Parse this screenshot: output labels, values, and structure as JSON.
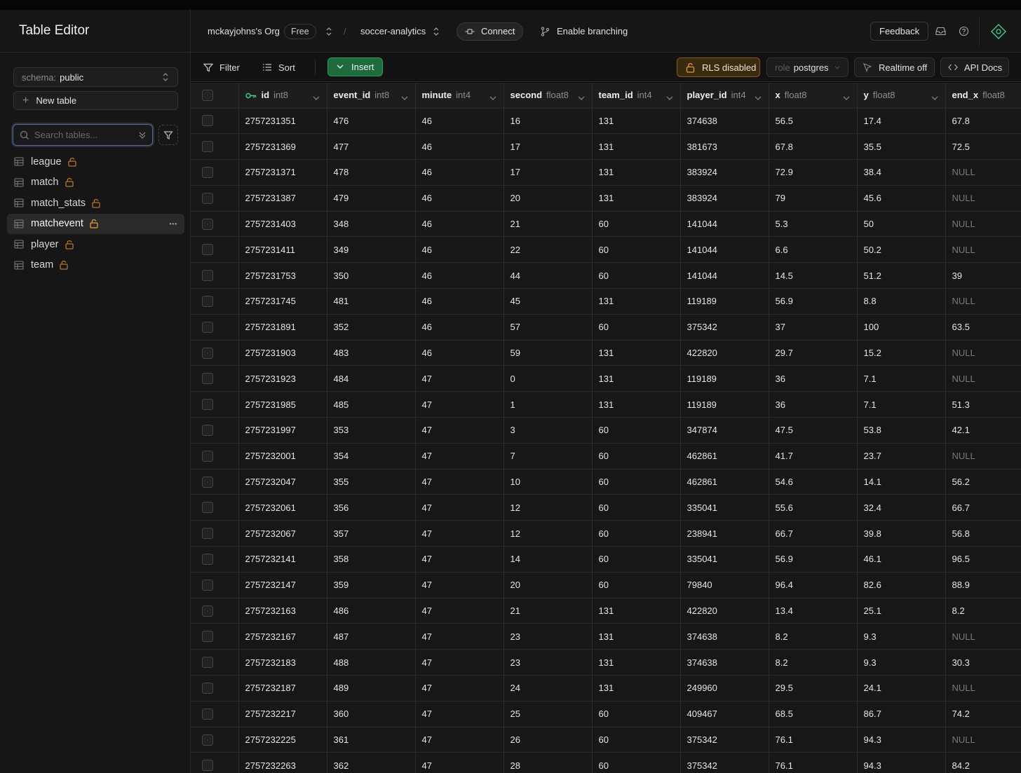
{
  "sidebar": {
    "title": "Table Editor",
    "schema_label": "schema:",
    "schema_value": "public",
    "new_table": "New table",
    "search_placeholder": "Search tables...",
    "tables": [
      {
        "name": "league",
        "active": false
      },
      {
        "name": "match",
        "active": false
      },
      {
        "name": "match_stats",
        "active": false
      },
      {
        "name": "matchevent",
        "active": true
      },
      {
        "name": "player",
        "active": false
      },
      {
        "name": "team",
        "active": false
      }
    ]
  },
  "topbar": {
    "org": "mckayjohns's Org",
    "plan": "Free",
    "separator": "/",
    "project": "soccer-analytics",
    "connect": "Connect",
    "branching": "Enable branching",
    "feedback": "Feedback"
  },
  "toolbar": {
    "filter": "Filter",
    "sort": "Sort",
    "insert": "Insert",
    "rls": "RLS disabled",
    "role_label": "role",
    "role_value": "postgres",
    "realtime": "Realtime off",
    "api_docs": "API Docs"
  },
  "colors": {
    "insert_green": "#1e6b3e",
    "rls_warning": "#8a5a1a",
    "lock_orange": "#d08a2a",
    "key_green": "#3ecf8e"
  },
  "grid": {
    "columns": [
      {
        "name": "id",
        "type": "int8",
        "primary": true
      },
      {
        "name": "event_id",
        "type": "int8"
      },
      {
        "name": "minute",
        "type": "int4"
      },
      {
        "name": "second",
        "type": "float8"
      },
      {
        "name": "team_id",
        "type": "int4"
      },
      {
        "name": "player_id",
        "type": "int4"
      },
      {
        "name": "x",
        "type": "float8"
      },
      {
        "name": "y",
        "type": "float8"
      },
      {
        "name": "end_x",
        "type": "float8"
      }
    ],
    "rows": [
      [
        "2757231351",
        "476",
        "46",
        "16",
        "131",
        "374638",
        "56.5",
        "17.4",
        "67.8"
      ],
      [
        "2757231369",
        "477",
        "46",
        "17",
        "131",
        "381673",
        "67.8",
        "35.5",
        "72.5"
      ],
      [
        "2757231371",
        "478",
        "46",
        "17",
        "131",
        "383924",
        "72.9",
        "38.4",
        "NULL"
      ],
      [
        "2757231387",
        "479",
        "46",
        "20",
        "131",
        "383924",
        "79",
        "45.6",
        "NULL"
      ],
      [
        "2757231403",
        "348",
        "46",
        "21",
        "60",
        "141044",
        "5.3",
        "50",
        "NULL"
      ],
      [
        "2757231411",
        "349",
        "46",
        "22",
        "60",
        "141044",
        "6.6",
        "50.2",
        "NULL"
      ],
      [
        "2757231753",
        "350",
        "46",
        "44",
        "60",
        "141044",
        "14.5",
        "51.2",
        "39"
      ],
      [
        "2757231745",
        "481",
        "46",
        "45",
        "131",
        "119189",
        "56.9",
        "8.8",
        "NULL"
      ],
      [
        "2757231891",
        "352",
        "46",
        "57",
        "60",
        "375342",
        "37",
        "100",
        "63.5"
      ],
      [
        "2757231903",
        "483",
        "46",
        "59",
        "131",
        "422820",
        "29.7",
        "15.2",
        "NULL"
      ],
      [
        "2757231923",
        "484",
        "47",
        "0",
        "131",
        "119189",
        "36",
        "7.1",
        "NULL"
      ],
      [
        "2757231985",
        "485",
        "47",
        "1",
        "131",
        "119189",
        "36",
        "7.1",
        "51.3"
      ],
      [
        "2757231997",
        "353",
        "47",
        "3",
        "60",
        "347874",
        "47.5",
        "53.8",
        "42.1"
      ],
      [
        "2757232001",
        "354",
        "47",
        "7",
        "60",
        "462861",
        "41.7",
        "23.7",
        "NULL"
      ],
      [
        "2757232047",
        "355",
        "47",
        "10",
        "60",
        "462861",
        "54.6",
        "14.1",
        "56.2"
      ],
      [
        "2757232061",
        "356",
        "47",
        "12",
        "60",
        "335041",
        "55.6",
        "32.4",
        "66.7"
      ],
      [
        "2757232067",
        "357",
        "47",
        "12",
        "60",
        "238941",
        "66.7",
        "39.8",
        "56.8"
      ],
      [
        "2757232141",
        "358",
        "47",
        "14",
        "60",
        "335041",
        "56.9",
        "46.1",
        "96.5"
      ],
      [
        "2757232147",
        "359",
        "47",
        "20",
        "60",
        "79840",
        "96.4",
        "82.6",
        "88.9"
      ],
      [
        "2757232163",
        "486",
        "47",
        "21",
        "131",
        "422820",
        "13.4",
        "25.1",
        "8.2"
      ],
      [
        "2757232167",
        "487",
        "47",
        "23",
        "131",
        "374638",
        "8.2",
        "9.3",
        "NULL"
      ],
      [
        "2757232183",
        "488",
        "47",
        "23",
        "131",
        "374638",
        "8.2",
        "9.3",
        "30.3"
      ],
      [
        "2757232187",
        "489",
        "47",
        "24",
        "131",
        "249960",
        "29.5",
        "24.1",
        "NULL"
      ],
      [
        "2757232217",
        "360",
        "47",
        "25",
        "60",
        "409467",
        "68.5",
        "86.7",
        "74.2"
      ],
      [
        "2757232225",
        "361",
        "47",
        "26",
        "60",
        "375342",
        "76.1",
        "94.3",
        "NULL"
      ],
      [
        "2757232263",
        "362",
        "47",
        "28",
        "60",
        "375342",
        "76.1",
        "94.3",
        "84.2"
      ]
    ]
  }
}
